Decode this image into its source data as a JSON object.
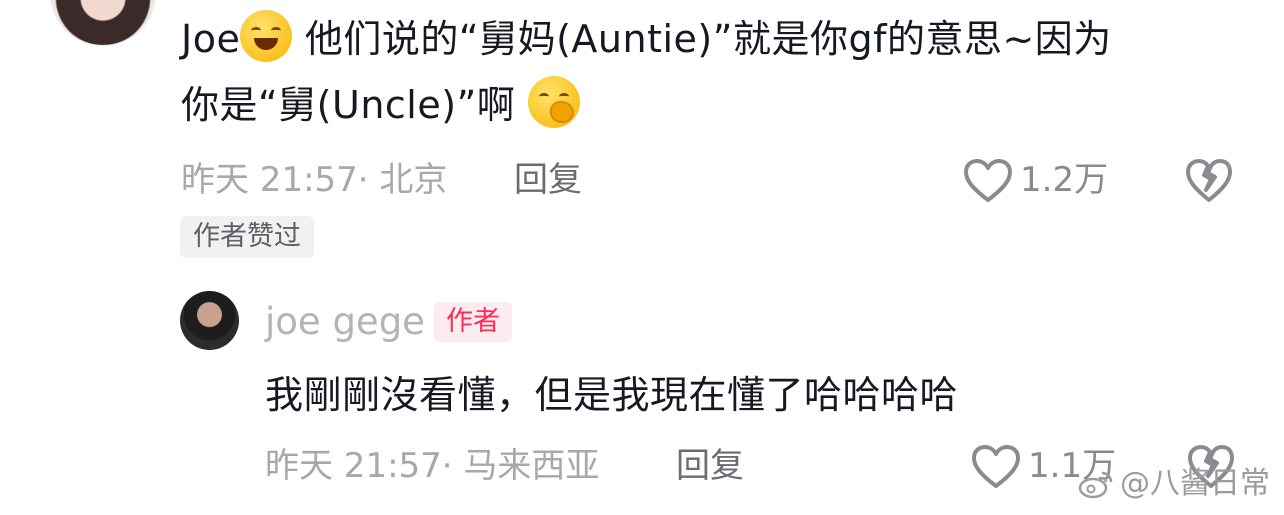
{
  "comment1": {
    "text_part1": "Joe",
    "emoji1_name": "laughing-tears-emoji",
    "text_part2": " 他们说的“舅妈(Auntie)”就是你gf的意思~因为",
    "text_line2": "你是“舅(Uncle)”啊 ",
    "emoji2_name": "smirk-hand-over-mouth-emoji",
    "time_location": "昨天 21:57· 北京",
    "reply_label": "回复",
    "like_count": "1.2万",
    "author_liked_tag": "作者赞过"
  },
  "comment2": {
    "username": "joe gege",
    "author_badge": "作者",
    "text": "我剛剛沒看懂，但是我現在懂了哈哈哈哈",
    "time_location": "昨天 21:57· 马来西亚",
    "reply_label": "回复",
    "like_count": "1.1万"
  },
  "watermark": {
    "text": "@八酱日常",
    "icon": "weibo-icon"
  },
  "colors": {
    "text": "#161823",
    "meta": "#a7a8ab",
    "author_badge": "#fe2c55",
    "tag_bg": "#f1f1f2"
  }
}
